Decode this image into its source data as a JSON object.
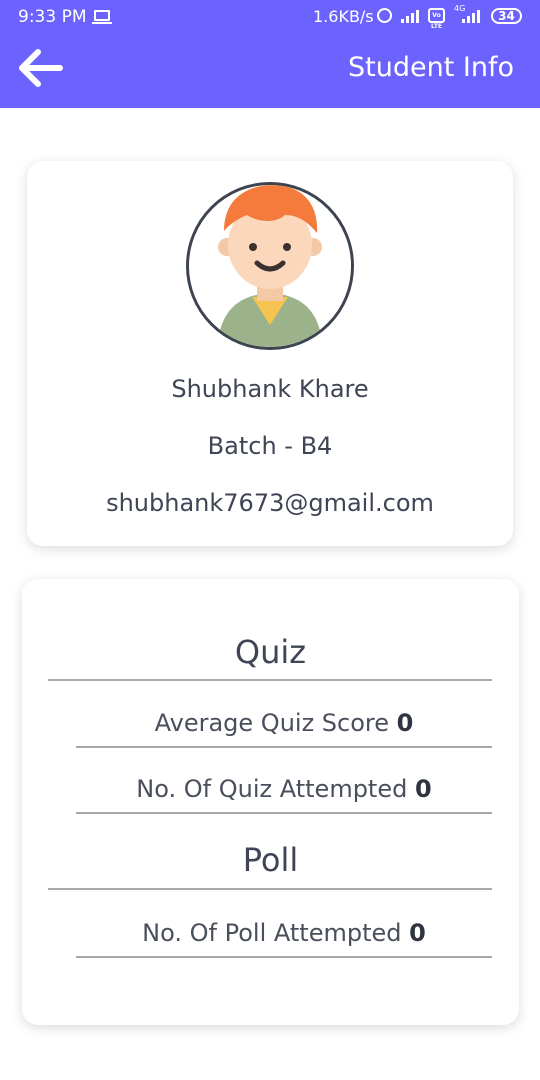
{
  "status_bar": {
    "time": "9:33 PM",
    "network_speed": "1.6KB/s",
    "network_type": "4G",
    "volte_label": "Vo LTE",
    "battery": "34"
  },
  "header": {
    "title": "Student Info"
  },
  "profile": {
    "name": "Shubhank Khare",
    "batch": "Batch - B4",
    "email": "shubhank7673@gmail.com"
  },
  "quiz": {
    "title": "Quiz",
    "average_label": "Average Quiz Score",
    "average_value": "0",
    "attempted_label": "No. Of Quiz Attempted",
    "attempted_value": "0"
  },
  "poll": {
    "title": "Poll",
    "attempted_label": "No. Of Poll Attempted",
    "attempted_value": "0"
  },
  "colors": {
    "accent": "#6c63ff",
    "text": "#3f4555",
    "line": "#a9a9ad"
  }
}
